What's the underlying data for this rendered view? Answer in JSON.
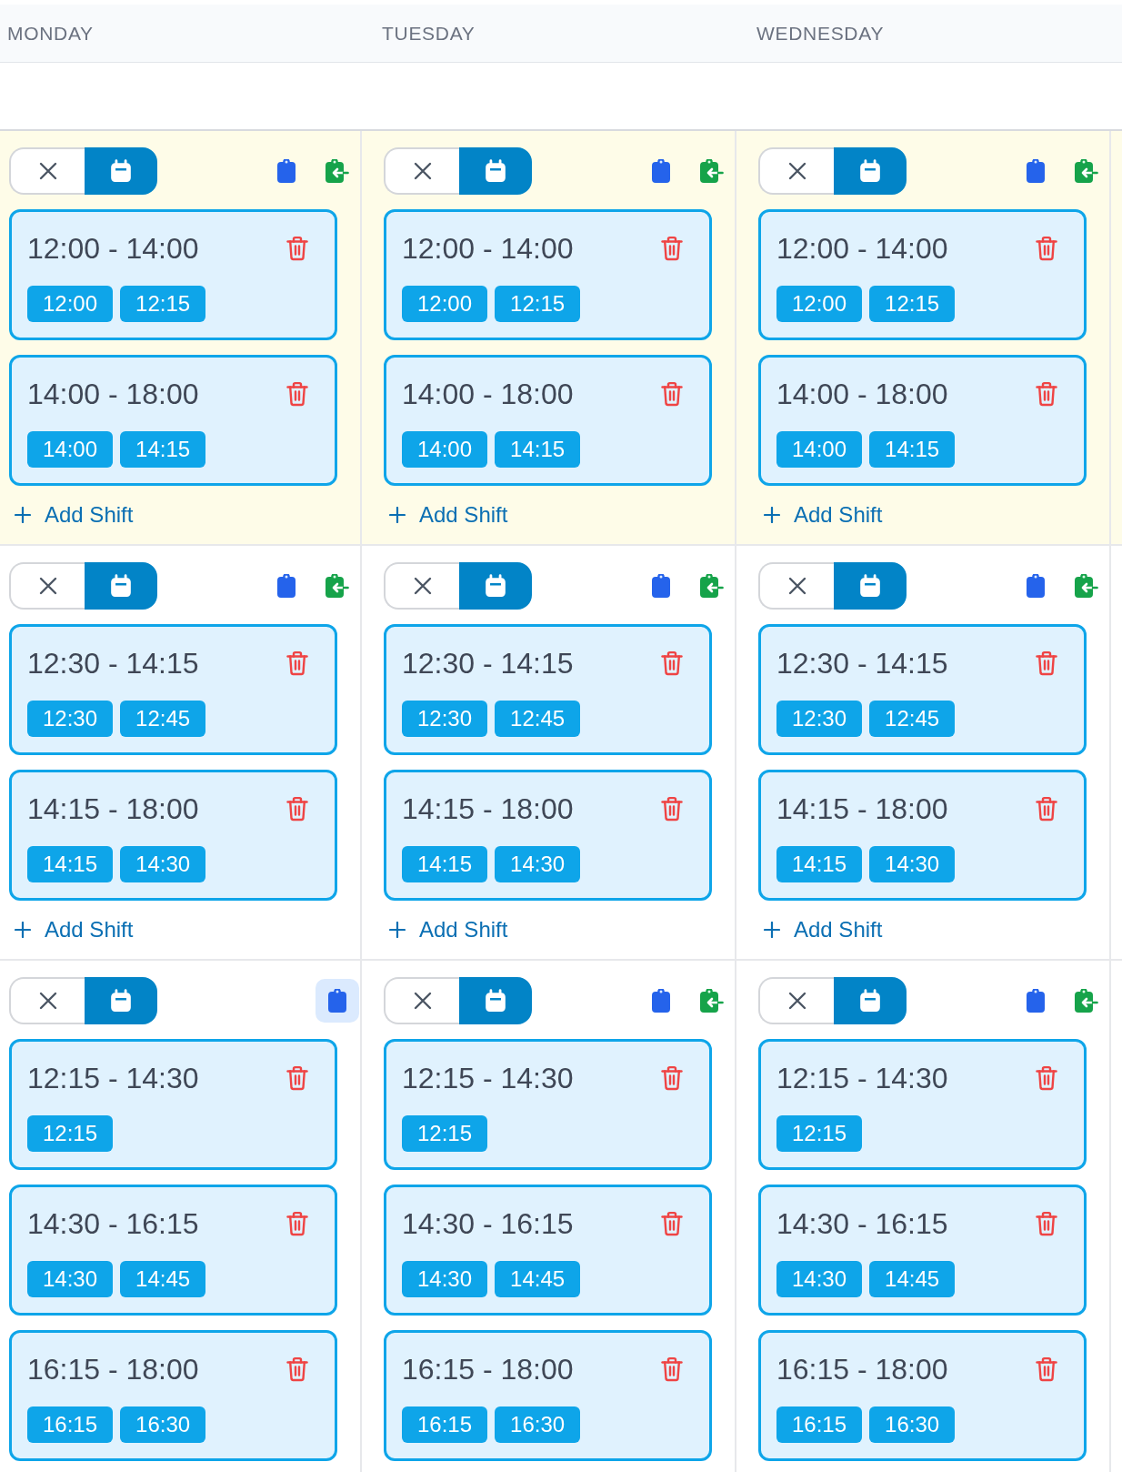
{
  "days": [
    {
      "label": "MONDAY"
    },
    {
      "label": "TUESDAY"
    },
    {
      "label": "WEDNESDAY"
    }
  ],
  "rows": [
    {
      "highlighted": true,
      "cells": [
        {
          "toggle": [
            {
              "kind": "cross",
              "selected": false
            },
            {
              "kind": "calendar",
              "selected": true
            }
          ],
          "actions": [
            {
              "kind": "clipboard",
              "active": false
            },
            {
              "kind": "clipboard-arrow",
              "active": false
            }
          ],
          "shifts": [
            {
              "range": "12:00 - 14:00",
              "slots": [
                "12:00",
                "12:15"
              ]
            },
            {
              "range": "14:00 - 18:00",
              "slots": [
                "14:00",
                "14:15"
              ]
            }
          ],
          "add_label": "Add Shift"
        },
        {
          "toggle": [
            {
              "kind": "cross",
              "selected": false
            },
            {
              "kind": "calendar",
              "selected": true
            }
          ],
          "actions": [
            {
              "kind": "clipboard",
              "active": false
            },
            {
              "kind": "clipboard-arrow",
              "active": false
            }
          ],
          "shifts": [
            {
              "range": "12:00 - 14:00",
              "slots": [
                "12:00",
                "12:15"
              ]
            },
            {
              "range": "14:00 - 18:00",
              "slots": [
                "14:00",
                "14:15"
              ]
            }
          ],
          "add_label": "Add Shift"
        },
        {
          "toggle": [
            {
              "kind": "cross",
              "selected": false
            },
            {
              "kind": "calendar",
              "selected": true
            }
          ],
          "actions": [
            {
              "kind": "clipboard",
              "active": false
            },
            {
              "kind": "clipboard-arrow",
              "active": false
            }
          ],
          "shifts": [
            {
              "range": "12:00 - 14:00",
              "slots": [
                "12:00",
                "12:15"
              ]
            },
            {
              "range": "14:00 - 18:00",
              "slots": [
                "14:00",
                "14:15"
              ]
            }
          ],
          "add_label": "Add Shift"
        }
      ]
    },
    {
      "highlighted": false,
      "cells": [
        {
          "toggle": [
            {
              "kind": "cross",
              "selected": false
            },
            {
              "kind": "calendar",
              "selected": true
            }
          ],
          "actions": [
            {
              "kind": "clipboard",
              "active": false
            },
            {
              "kind": "clipboard-arrow",
              "active": false
            }
          ],
          "shifts": [
            {
              "range": "12:30 - 14:15",
              "slots": [
                "12:30",
                "12:45"
              ]
            },
            {
              "range": "14:15 - 18:00",
              "slots": [
                "14:15",
                "14:30"
              ]
            }
          ],
          "add_label": "Add Shift"
        },
        {
          "toggle": [
            {
              "kind": "cross",
              "selected": false
            },
            {
              "kind": "calendar",
              "selected": true
            }
          ],
          "actions": [
            {
              "kind": "clipboard",
              "active": false
            },
            {
              "kind": "clipboard-arrow",
              "active": false
            }
          ],
          "shifts": [
            {
              "range": "12:30 - 14:15",
              "slots": [
                "12:30",
                "12:45"
              ]
            },
            {
              "range": "14:15 - 18:00",
              "slots": [
                "14:15",
                "14:30"
              ]
            }
          ],
          "add_label": "Add Shift"
        },
        {
          "toggle": [
            {
              "kind": "cross",
              "selected": false
            },
            {
              "kind": "calendar",
              "selected": true
            }
          ],
          "actions": [
            {
              "kind": "clipboard",
              "active": false
            },
            {
              "kind": "clipboard-arrow",
              "active": false
            }
          ],
          "shifts": [
            {
              "range": "12:30 - 14:15",
              "slots": [
                "12:30",
                "12:45"
              ]
            },
            {
              "range": "14:15 - 18:00",
              "slots": [
                "14:15",
                "14:30"
              ]
            }
          ],
          "add_label": "Add Shift"
        }
      ]
    },
    {
      "highlighted": false,
      "cells": [
        {
          "toggle": [
            {
              "kind": "cross",
              "selected": false
            },
            {
              "kind": "calendar",
              "selected": true
            }
          ],
          "actions": [
            {
              "kind": "clipboard",
              "active": true
            }
          ],
          "shifts": [
            {
              "range": "12:15 - 14:30",
              "slots": [
                "12:15"
              ]
            },
            {
              "range": "14:30 - 16:15",
              "slots": [
                "14:30",
                "14:45"
              ]
            },
            {
              "range": "16:15 - 18:00",
              "slots": [
                "16:15",
                "16:30"
              ]
            }
          ]
        },
        {
          "toggle": [
            {
              "kind": "cross",
              "selected": false
            },
            {
              "kind": "calendar",
              "selected": true
            }
          ],
          "actions": [
            {
              "kind": "clipboard",
              "active": false
            },
            {
              "kind": "clipboard-arrow",
              "active": false
            }
          ],
          "shifts": [
            {
              "range": "12:15 - 14:30",
              "slots": [
                "12:15"
              ]
            },
            {
              "range": "14:30 - 16:15",
              "slots": [
                "14:30",
                "14:45"
              ]
            },
            {
              "range": "16:15 - 18:00",
              "slots": [
                "16:15",
                "16:30"
              ]
            }
          ]
        },
        {
          "toggle": [
            {
              "kind": "cross",
              "selected": false
            },
            {
              "kind": "calendar",
              "selected": true
            }
          ],
          "actions": [
            {
              "kind": "clipboard",
              "active": false
            },
            {
              "kind": "clipboard-arrow",
              "active": false
            }
          ],
          "shifts": [
            {
              "range": "12:15 - 14:30",
              "slots": [
                "12:15"
              ]
            },
            {
              "range": "14:30 - 16:15",
              "slots": [
                "14:30",
                "14:45"
              ]
            },
            {
              "range": "16:15 - 18:00",
              "slots": [
                "16:15",
                "16:30"
              ]
            }
          ]
        }
      ]
    }
  ]
}
